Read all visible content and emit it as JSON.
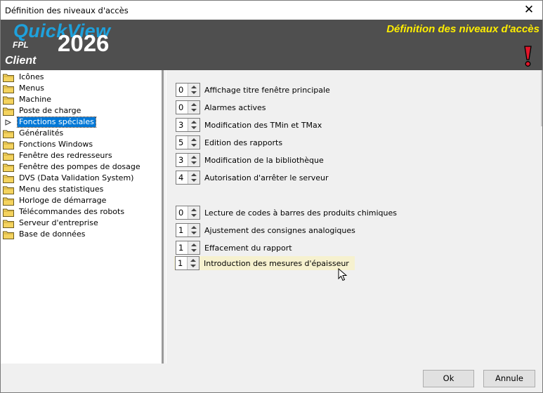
{
  "window": {
    "title": "Définition des niveaux d'accès",
    "close_icon": "close-icon"
  },
  "banner": {
    "brand": "QuickView",
    "year": "2026",
    "edition": "FPL",
    "user": "Client",
    "heading": "Définition des niveaux d'accès",
    "brand_color": "#1ea1dc",
    "heading_color": "#ffee00",
    "warning_icon": "exclamation-icon"
  },
  "tree": {
    "items": [
      {
        "label": "Icônes",
        "icon": "folder-icon"
      },
      {
        "label": "Menus",
        "icon": "folder-icon"
      },
      {
        "label": "Machine",
        "icon": "folder-icon"
      },
      {
        "label": "Poste de charge",
        "icon": "folder-icon"
      },
      {
        "label": "Fonctions spéciales",
        "icon": "arrow-icon",
        "selected": true
      },
      {
        "label": "Généralités",
        "icon": "folder-icon"
      },
      {
        "label": "Fonctions Windows",
        "icon": "folder-icon"
      },
      {
        "label": "Fenêtre des redresseurs",
        "icon": "folder-icon"
      },
      {
        "label": "Fenêtre des pompes de dosage",
        "icon": "folder-icon"
      },
      {
        "label": "DVS (Data Validation System)",
        "icon": "folder-icon"
      },
      {
        "label": "Menu des statistiques",
        "icon": "folder-icon"
      },
      {
        "label": "Horloge de démarrage",
        "icon": "folder-icon"
      },
      {
        "label": "Télécommandes des robots",
        "icon": "folder-icon"
      },
      {
        "label": "Serveur d'entreprise",
        "icon": "folder-icon"
      },
      {
        "label": "Base de données",
        "icon": "folder-icon"
      }
    ]
  },
  "settings": [
    {
      "value": "0",
      "label": "Affichage titre fenêtre principale"
    },
    {
      "value": "0",
      "label": "Alarmes actives"
    },
    {
      "value": "3",
      "label": "Modification des TMin et TMax"
    },
    {
      "value": "5",
      "label": "Edition des rapports"
    },
    {
      "value": "3",
      "label": "Modification de la bibliothèque"
    },
    {
      "value": "4",
      "label": "Autorisation d'arrêter le serveur"
    },
    {
      "value": "0",
      "label": "Lecture de codes à barres des produits chimiques"
    },
    {
      "value": "1",
      "label": "Ajustement des consignes analogiques"
    },
    {
      "value": "1",
      "label": "Effacement du rapport"
    },
    {
      "value": "1",
      "label": "Introduction des mesures d'épaisseur",
      "highlighted": true
    }
  ],
  "footer": {
    "ok_label": "Ok",
    "cancel_label": "Annule"
  }
}
